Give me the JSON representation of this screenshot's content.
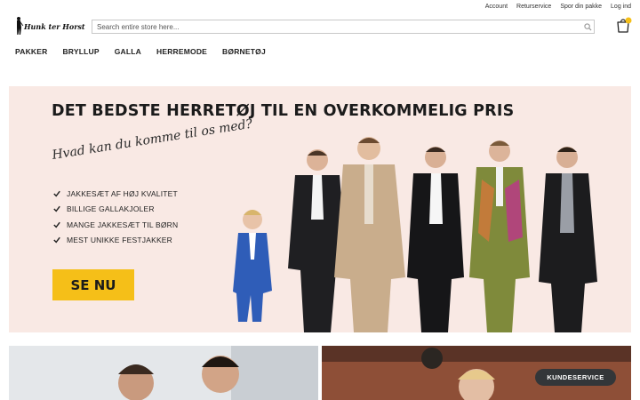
{
  "top_links": [
    "Account",
    "Returservice",
    "Spor din pakke",
    "Log ind"
  ],
  "logo_text": "Hunk ter Horst",
  "search": {
    "placeholder": "Search entire store here..."
  },
  "nav": [
    "PAKKER",
    "BRYLLUP",
    "GALLA",
    "HERREMODE",
    "BØRNETØJ"
  ],
  "hero": {
    "title": "DET BEDSTE HERRETØJ TIL EN OVERKOMMELIG PRIS",
    "script": "Hvad kan du komme til os med?",
    "features": [
      "JAKKESÆT AF HØJ KVALITET",
      "BILLIGE GALLAKJOLER",
      "MANGE JAKKESÆT TIL BØRN",
      "MEST UNIKKE FESTJAKKER"
    ],
    "cta": "SE NU"
  },
  "service_button": "KUNDESERVICE",
  "colors": {
    "accent": "#f5bf18",
    "hero_bg": "#f9e9e4",
    "cart_badge": "#f5bf18"
  },
  "icons": {
    "search": "search-icon",
    "cart": "shopping-bag-icon",
    "check": "check-icon"
  }
}
